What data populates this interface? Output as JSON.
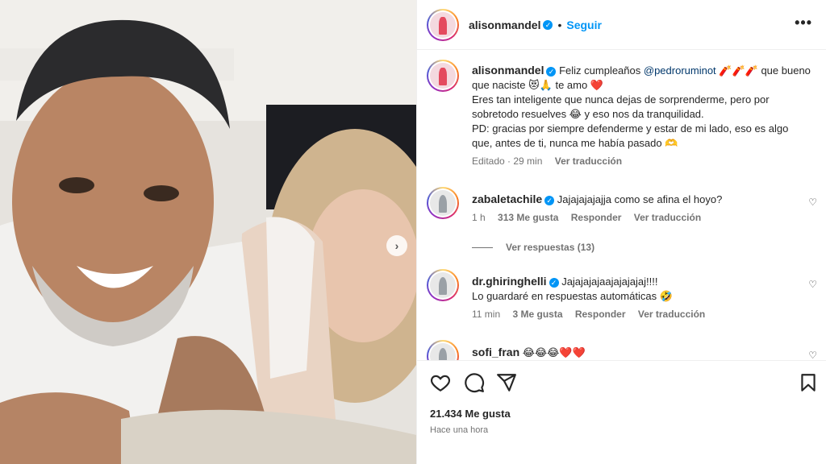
{
  "post": {
    "username": "alisonmandel",
    "follow_label": "Seguir",
    "dot": "•",
    "more_label": "•••",
    "next_label": "›"
  },
  "caption": {
    "username": "alisonmandel",
    "line1_prefix": "Feliz cumpleaños ",
    "mention": "@pedroruminot",
    "line1_suffix": " 🧨🧨🧨 que bueno que naciste 😻🙏 te amo ❤️",
    "line2": "Eres tan inteligente que nunca dejas de sorprenderme, pero por sobretodo resuelves 😂 y eso nos da tranquilidad.",
    "line3": "PD: gracias por siempre defenderme y estar de mi lado, eso es algo que, antes de ti, nunca me había pasado 🫶",
    "edited": "Editado · 29 min",
    "translate": "Ver traducción"
  },
  "comments": [
    {
      "username": "zabaletachile",
      "text": "Jajajajajajja como se afina el hoyo?",
      "time": "1 h",
      "likes": "313 Me gusta",
      "reply": "Responder",
      "translate": "Ver traducción",
      "replies": "Ver respuestas (13)"
    },
    {
      "username": "dr.ghiringhelli",
      "text": "Jajajajajaajajajajaj!!!!",
      "text2": "Lo guardaré en respuestas automáticas 🤣",
      "time": "11 min",
      "likes": "3 Me gusta",
      "reply": "Responder",
      "translate": "Ver traducción"
    },
    {
      "username": "sofi_fran",
      "text": "😂😂😂❤️❤️"
    }
  ],
  "footer": {
    "likes": "21.434 Me gusta",
    "time": "Hace una hora"
  },
  "icons": {
    "heart": "heart-icon",
    "comment": "comment-icon",
    "share": "share-icon",
    "save": "bookmark-icon"
  },
  "colors": {
    "accent": "#0095f6",
    "muted": "#737373",
    "text": "#262626"
  }
}
